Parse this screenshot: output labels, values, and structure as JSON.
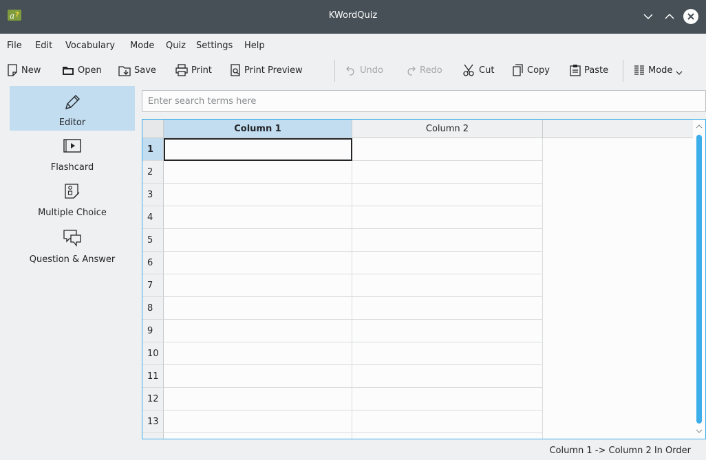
{
  "window": {
    "title": "KWordQuiz",
    "controls": [
      "minimize",
      "maximize",
      "close"
    ]
  },
  "menubar": {
    "items": [
      "File",
      "Edit",
      "Vocabulary",
      "Mode",
      "Quiz",
      "Settings",
      "Help"
    ]
  },
  "toolbar": {
    "new": "New",
    "open": "Open",
    "save": "Save",
    "print": "Print",
    "print_preview": "Print Preview",
    "undo": "Undo",
    "redo": "Redo",
    "cut": "Cut",
    "copy": "Copy",
    "paste": "Paste",
    "mode": "Mode",
    "disabled": [
      "undo",
      "redo"
    ]
  },
  "sidebar": {
    "items": [
      {
        "label": "Editor",
        "icon": "pencil-icon",
        "active": true
      },
      {
        "label": "Flashcard",
        "icon": "flashcard-icon",
        "active": false
      },
      {
        "label": "Multiple Choice",
        "icon": "multiple-choice-icon",
        "active": false
      },
      {
        "label": "Question & Answer",
        "icon": "question-answer-icon",
        "active": false
      }
    ]
  },
  "search": {
    "placeholder": "Enter search terms here",
    "value": ""
  },
  "table": {
    "columns": [
      "Column 1",
      "Column 2"
    ],
    "selected_column": 0,
    "current_row": 1,
    "rows": [
      {
        "num": "1",
        "col1": "",
        "col2": ""
      },
      {
        "num": "2",
        "col1": "",
        "col2": ""
      },
      {
        "num": "3",
        "col1": "",
        "col2": ""
      },
      {
        "num": "4",
        "col1": "",
        "col2": ""
      },
      {
        "num": "5",
        "col1": "",
        "col2": ""
      },
      {
        "num": "6",
        "col1": "",
        "col2": ""
      },
      {
        "num": "7",
        "col1": "",
        "col2": ""
      },
      {
        "num": "8",
        "col1": "",
        "col2": ""
      },
      {
        "num": "9",
        "col1": "",
        "col2": ""
      },
      {
        "num": "10",
        "col1": "",
        "col2": ""
      },
      {
        "num": "11",
        "col1": "",
        "col2": ""
      },
      {
        "num": "12",
        "col1": "",
        "col2": ""
      },
      {
        "num": "13",
        "col1": "",
        "col2": ""
      }
    ]
  },
  "statusbar": {
    "text": "Column 1 -> Column 2 In Order"
  },
  "colors": {
    "accent": "#3daee9",
    "selection": "#c2dcf0",
    "titlebar": "#475057",
    "window_bg": "#eff0f1",
    "text": "#232629"
  }
}
